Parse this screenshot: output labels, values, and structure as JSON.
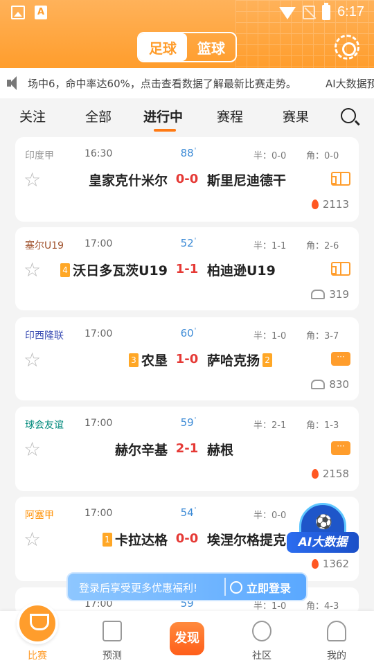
{
  "status_bar": {
    "time": "6:17",
    "app_icon_letter": "A"
  },
  "sport_tabs": [
    "足球",
    "篮球"
  ],
  "marquee": {
    "text": "场中6，命中率达60%，点击查看数据了解最新比赛走势。",
    "text2": "AI大数据预"
  },
  "tabs": [
    "关注",
    "全部",
    "进行中",
    "赛程",
    "赛果"
  ],
  "active_tab": "进行中",
  "matches": [
    {
      "league": "印度甲",
      "league_color": "#999999",
      "time": "16:30",
      "minute": "88",
      "half": "半：0-0",
      "corner": "角：0-0",
      "home": "皇家克什米尔",
      "home_rank": "",
      "score": "0-0",
      "away": "斯里尼迪德干",
      "away_rank": "",
      "icon": "field-icon",
      "heat_type": "fire",
      "heat": "2113"
    },
    {
      "league": "塞尔U19",
      "league_color": "#a0522d",
      "time": "17:00",
      "minute": "52",
      "half": "半：1-1",
      "corner": "角：2-6",
      "home": "沃日多瓦茨U19",
      "home_rank": "4",
      "score": "1-1",
      "away": "柏迪逊U19",
      "away_rank": "",
      "icon": "field-icon",
      "heat_type": "people",
      "heat": "319"
    },
    {
      "league": "印西隆联",
      "league_color": "#3f51b5",
      "time": "17:00",
      "minute": "60",
      "half": "半：1-0",
      "corner": "角：3-7",
      "home": "农垦",
      "home_rank": "3",
      "score": "1-0",
      "away": "萨哈克扬",
      "away_rank": "2",
      "icon": "chat-icon",
      "heat_type": "people",
      "heat": "830"
    },
    {
      "league": "球会友谊",
      "league_color": "#00897b",
      "time": "17:00",
      "minute": "59",
      "half": "半：2-1",
      "corner": "角：1-3",
      "home": "赫尔辛基",
      "home_rank": "",
      "score": "2-1",
      "away": "赫根",
      "away_rank": "",
      "icon": "chat-icon",
      "heat_type": "fire",
      "heat": "2158"
    },
    {
      "league": "阿塞甲",
      "league_color": "#ff8f00",
      "time": "17:00",
      "minute": "54",
      "half": "半：0-0",
      "corner": "",
      "home": "卡拉达格",
      "home_rank": "1",
      "score": "0-0",
      "away": "埃涅尔格提克",
      "away_rank": "",
      "icon": "",
      "heat_type": "fire",
      "heat": "1362"
    },
    {
      "league": "",
      "league_color": "#2e7d32",
      "time": "17:00",
      "minute": "59",
      "half": "半：1-0",
      "corner": "角：4-3",
      "home": "",
      "home_rank": "",
      "score": "",
      "away": "",
      "away_rank": "",
      "icon": "",
      "heat_type": "",
      "heat": ""
    }
  ],
  "ai_badge": "AI大数据",
  "login_banner": {
    "text": "登录后享受更多优惠福利!",
    "button": "立即登录"
  },
  "bottom_nav": [
    "比赛",
    "预测",
    "发现",
    "社区",
    "我的"
  ],
  "colors": {
    "brand": "#ff9d2c",
    "score": "#e53935",
    "minute": "#3d8bd6"
  }
}
